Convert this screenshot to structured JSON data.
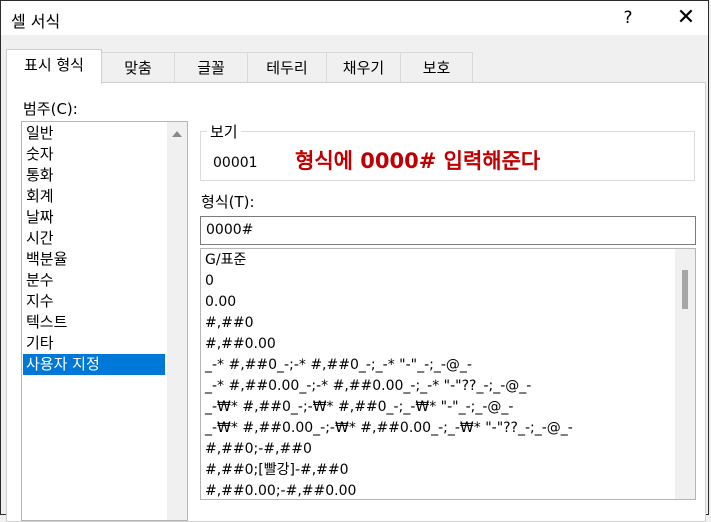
{
  "window": {
    "title": "셀 서식",
    "help_label": "?",
    "close_label": "✕"
  },
  "tabs": [
    {
      "label": "표시 형식",
      "active": true
    },
    {
      "label": "맞춤"
    },
    {
      "label": "글꼴"
    },
    {
      "label": "테두리"
    },
    {
      "label": "채우기"
    },
    {
      "label": "보호"
    }
  ],
  "category": {
    "label": "범주(C):",
    "items": [
      "일반",
      "숫자",
      "통화",
      "회계",
      "날짜",
      "시간",
      "백분율",
      "분수",
      "지수",
      "텍스트",
      "기타",
      "사용자 지정"
    ],
    "selected": "사용자 지정"
  },
  "preview": {
    "legend": "보기",
    "value": "00001"
  },
  "annotation": "형식에 0000# 입력해준다",
  "format": {
    "label": "형식(T):",
    "input_value": "0000#",
    "list": [
      "G/표준",
      "0",
      "0.00",
      "#,##0",
      "#,##0.00",
      "_-* #,##0_-;-* #,##0_-;_-* \"-\"_-;_-@_-",
      "_-* #,##0.00_-;-* #,##0.00_-;_-* \"-\"??_-;_-@_-",
      "_-₩* #,##0_-;-₩* #,##0_-;_-₩* \"-\"_-;_-@_-",
      "_-₩* #,##0.00_-;-₩* #,##0.00_-;_-₩* \"-\"??_-;_-@_-",
      "#,##0;-#,##0",
      "#,##0;[빨강]-#,##0",
      "#,##0.00;-#,##0.00"
    ]
  },
  "colors": {
    "selection": "#0078d7",
    "annotation": "#c00000"
  }
}
